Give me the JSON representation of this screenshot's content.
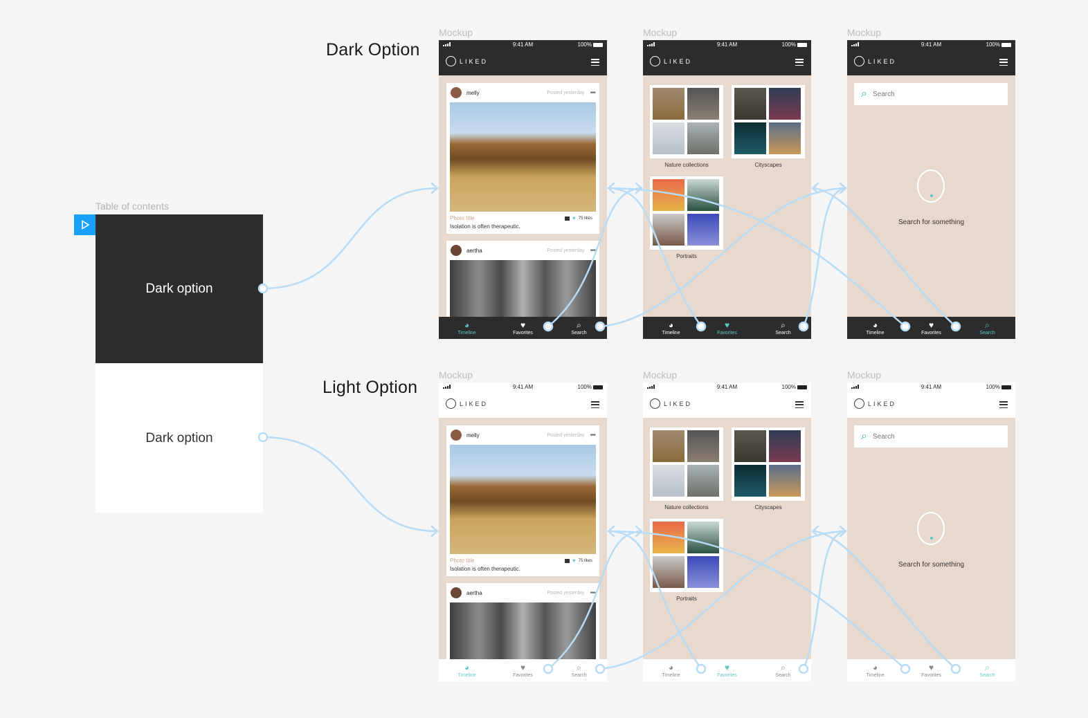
{
  "toc": {
    "label": "Table of contents",
    "dark_card": "Dark option",
    "light_card": "Dark option"
  },
  "sections": {
    "dark_title": "Dark Option",
    "light_title": "Light Option"
  },
  "mock_label": "Mockup",
  "status": {
    "time": "9:41 AM",
    "battery": "100%"
  },
  "app": {
    "logo": "LIKED"
  },
  "posts": [
    {
      "user": "melly",
      "when": "Posted yesterday",
      "title": "Photo title",
      "desc": "Isolation is often therapeutic.",
      "likes": "75 likes"
    },
    {
      "user": "aertha",
      "when": "Posted yesterday"
    }
  ],
  "collections": [
    "Nature collections",
    "Cityscapes",
    "Portraits"
  ],
  "tabs": [
    "Timeline",
    "Favorites",
    "Search"
  ],
  "search": {
    "placeholder": "Search",
    "empty": "Search for something"
  },
  "colors": {
    "accent": "#5ec9c4",
    "dark": "#2c2c2c",
    "canvas": "#e8d9ce",
    "prototype_link": "#b9dcf6",
    "prototype_blue": "#18a0fb"
  }
}
